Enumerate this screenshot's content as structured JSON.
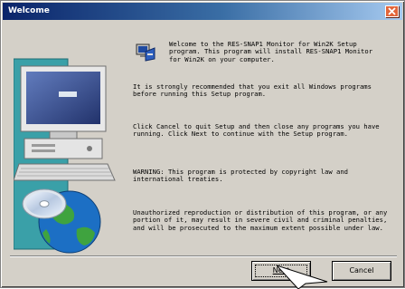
{
  "window": {
    "title": "Welcome",
    "close_icon": "close-icon"
  },
  "content": {
    "intro": "Welcome to the RES-SNAP1 Monitor for Win2K Setup program.  This program will install RES-SNAP1 Monitor for Win2K on your computer.",
    "paragraphs": [
      "It is strongly recommended that you exit all Windows programs before running this Setup program.",
      "Click Cancel to quit Setup and then close any programs you have running.  Click Next to continue with the Setup program.",
      "WARNING: This program is protected by copyright law and international treaties.",
      "Unauthorized reproduction or distribution of this program, or any portion of it, may result in severe civil and criminal penalties, and will be prosecuted to the maximum extent possible under law."
    ]
  },
  "buttons": {
    "next": "Next",
    "cancel": "Cancel"
  },
  "icons": {
    "setup": "setup-icon",
    "computer": "computer-illustration",
    "globe": "globe-cd-illustration",
    "cursor": "mouse-cursor-icon"
  },
  "colors": {
    "titlebar_start": "#0a246a",
    "titlebar_end": "#a6caf0",
    "dialog_bg": "#d4d0c8",
    "close_button": "#e2653a"
  }
}
